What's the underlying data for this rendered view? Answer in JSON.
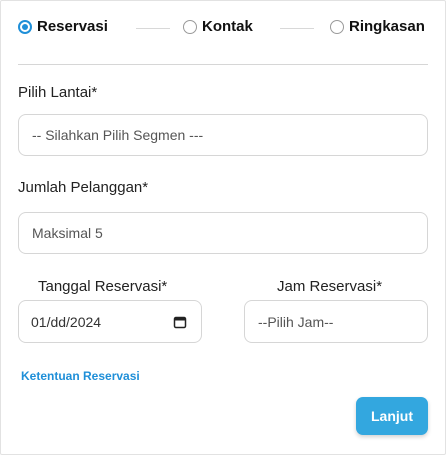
{
  "steps": {
    "step1": {
      "label": "Reservasi",
      "active": true
    },
    "step2": {
      "label": "Kontak",
      "active": false
    },
    "step3": {
      "label": "Ringkasan",
      "active": false
    }
  },
  "form": {
    "floor": {
      "label": "Pilih Lantai*",
      "placeholder": "-- Silahkan Pilih Segmen ---"
    },
    "guests": {
      "label": "Jumlah Pelanggan*",
      "placeholder": "Maksimal 5"
    },
    "date": {
      "label": "Tanggal Reservasi*",
      "value": "01/dd/2024"
    },
    "time": {
      "label": "Jam Reservasi*",
      "placeholder": "--Pilih Jam--"
    }
  },
  "terms_link": "Ketentuan Reservasi",
  "next_button": "Lanjut",
  "colors": {
    "accent": "#1f8fd8",
    "button": "#33a7df"
  }
}
